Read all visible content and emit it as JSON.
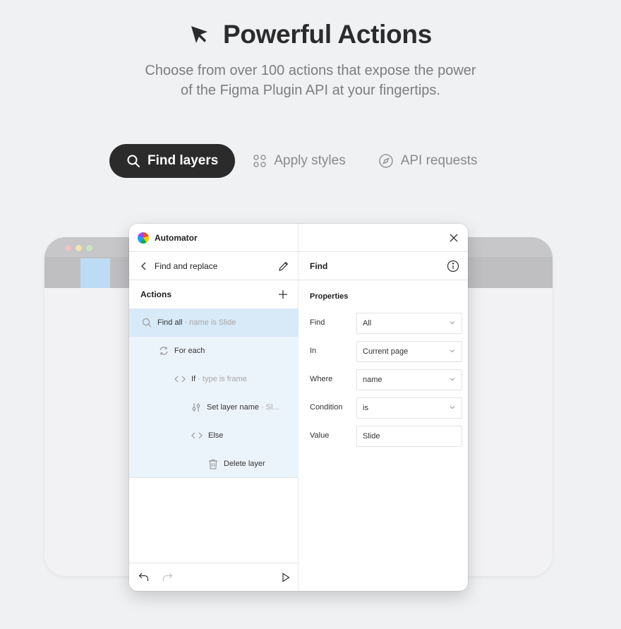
{
  "hero": {
    "title": "Powerful Actions",
    "title_icon": "cursor-arrow-icon",
    "subtitle_line1": "Choose from over 100 actions that expose the power",
    "subtitle_line2": "of the Figma Plugin API at your fingertips."
  },
  "tabs": [
    {
      "label": "Find layers",
      "icon": "search-icon",
      "active": true
    },
    {
      "label": "Apply styles",
      "icon": "grid-dots-icon",
      "active": false
    },
    {
      "label": "API requests",
      "icon": "compass-icon",
      "active": false
    }
  ],
  "colors": {
    "tab_active_bg": "#2b2b2b",
    "selected_row": "#d8e9f7",
    "list_bg": "#ecf4fb",
    "browser_tab_blue": "#bcdcf6",
    "dot_red": "#f2c1c1",
    "dot_yellow": "#f2e3b0",
    "dot_green": "#c8e6c0"
  },
  "plugin": {
    "app_name": "Automator",
    "left": {
      "header": "Find and replace",
      "section": "Actions",
      "actions": [
        {
          "icon": "search-icon",
          "label": "Find all",
          "meta": " · name is Slide"
        },
        {
          "icon": "loop-icon",
          "label": "For each",
          "meta": ""
        },
        {
          "icon": "code-brackets-icon",
          "label": "If",
          "meta": " · type is frame"
        },
        {
          "icon": "sliders-icon",
          "label": "Set layer name",
          "meta": " · Sl..."
        },
        {
          "icon": "code-brackets-icon",
          "label": "Else",
          "meta": ""
        },
        {
          "icon": "trash-icon",
          "label": "Delete layer",
          "meta": ""
        }
      ]
    },
    "right": {
      "header": "Find",
      "section": "Properties",
      "properties": [
        {
          "label": "Find",
          "value": "All",
          "dropdown": true
        },
        {
          "label": "In",
          "value": "Current page",
          "dropdown": true
        },
        {
          "label": "Where",
          "value": "name",
          "dropdown": true
        },
        {
          "label": "Condition",
          "value": "is",
          "dropdown": true
        },
        {
          "label": "Value",
          "value": "Slide",
          "dropdown": false
        }
      ]
    }
  }
}
